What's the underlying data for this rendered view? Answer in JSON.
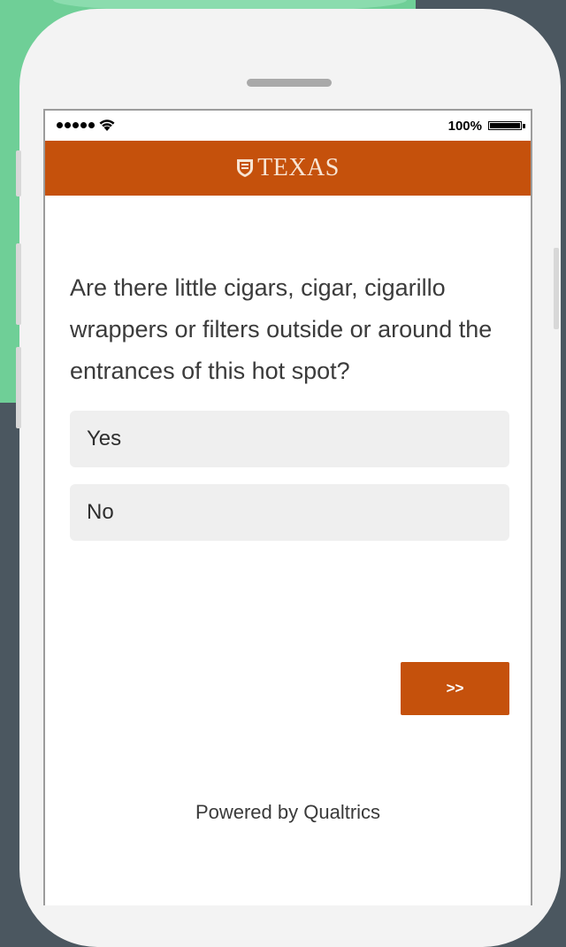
{
  "status_bar": {
    "battery_percent": "100%"
  },
  "header": {
    "logo_text": "TEXAS",
    "color": "#c5510c"
  },
  "survey": {
    "question": "Are there little cigars, cigar, cigarillo wrappers or filters outside or around the entrances of this hot spot?",
    "choices": [
      "Yes",
      "No"
    ],
    "next_label": ">>"
  },
  "footer": {
    "text": "Powered by Qualtrics"
  },
  "icons": {
    "signal": "signal-dots-icon",
    "wifi": "wifi-icon",
    "battery": "battery-icon",
    "logo": "shield-icon"
  }
}
